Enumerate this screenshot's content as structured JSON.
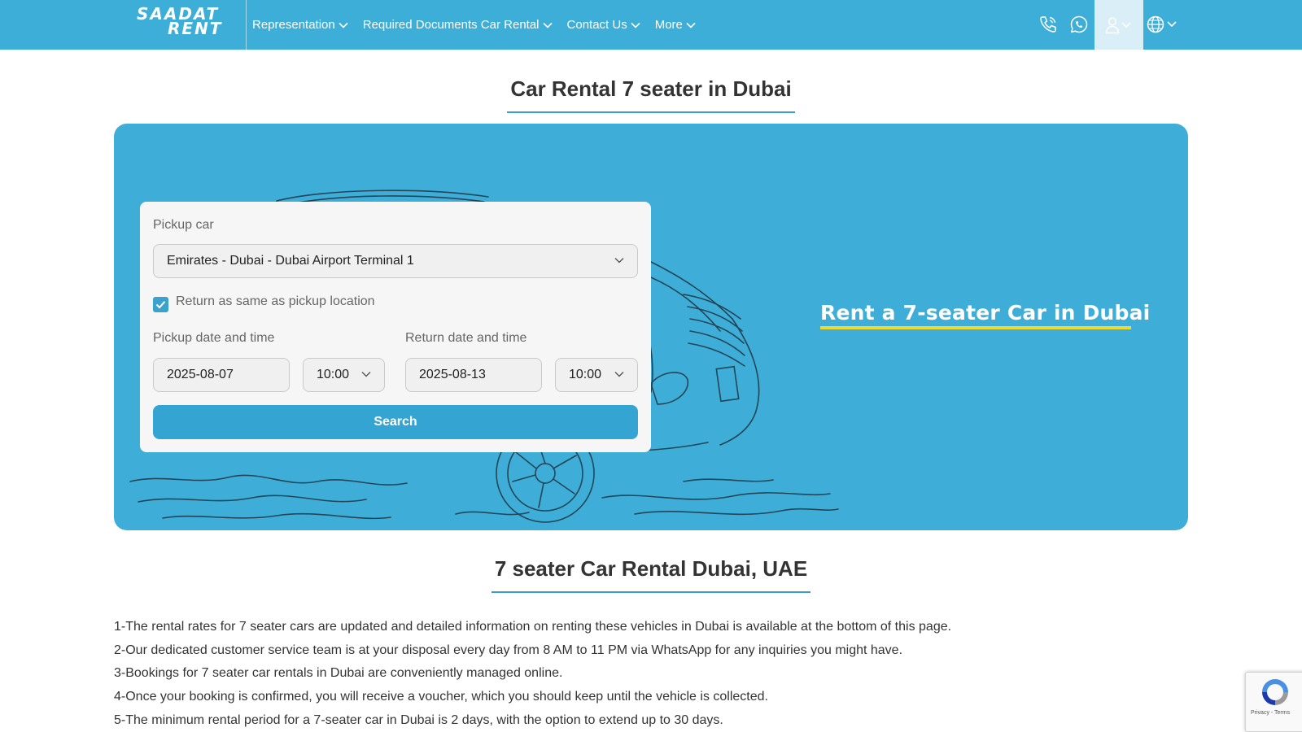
{
  "header": {
    "logo": {
      "line1": "SAADAT",
      "line2": "RENT"
    },
    "nav": [
      {
        "label": "Representation"
      },
      {
        "label": "Required Documents Car Rental"
      },
      {
        "label": "Contact Us"
      },
      {
        "label": "More"
      }
    ],
    "icons": [
      "phone-icon",
      "whatsapp-icon",
      "user-icon",
      "globe-icon"
    ]
  },
  "page_title": "Car Rental 7 seater in Dubai",
  "hero": {
    "tagline": "Rent a 7-seater Car in Dubai",
    "colors": {
      "background": "#3eaed8",
      "underline": "#f2d92e"
    }
  },
  "booking": {
    "pickup_label": "Pickup car",
    "pickup_location": "Emirates - Dubai - Dubai Airport Terminal 1",
    "return_same_label": "Return as same as pickup location",
    "return_same_checked": true,
    "pickup_dt_label": "Pickup date and time",
    "pickup_date": "2025-08-07",
    "pickup_time": "10:00",
    "return_dt_label": "Return date and time",
    "return_date": "2025-08-13",
    "return_time": "10:00",
    "search_label": "Search"
  },
  "section_title": "7 seater Car Rental Dubai, UAE",
  "info_items": [
    "1-The rental rates for 7 seater cars are updated and detailed information on renting these vehicles in Dubai is available at the bottom of this page.",
    "2-Our dedicated customer service team is at your disposal every day from 8 AM to 11 PM via WhatsApp for any inquiries you might have.",
    "3-Bookings for 7 seater car rentals in Dubai are conveniently managed online.",
    "4-Once your booking is confirmed, you will receive a voucher, which you should keep until the vehicle is collected.",
    "5-The minimum rental period for a 7-seater car in Dubai is 2 days, with the option to extend up to 30 days."
  ],
  "recaptcha": {
    "links": "Privacy - Terms"
  },
  "colors": {
    "brand": "#3daed8",
    "button": "#34a4d2",
    "title_underline": "#3a9ec8"
  }
}
